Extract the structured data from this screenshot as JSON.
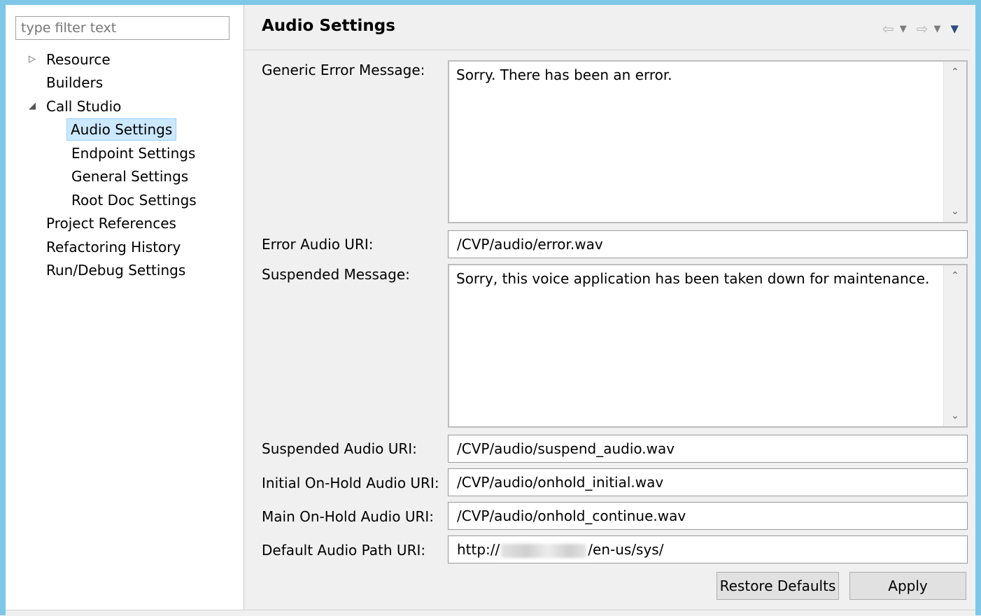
{
  "filter": {
    "placeholder": "type filter text"
  },
  "tree": {
    "items": [
      {
        "label": "Resource"
      },
      {
        "label": "Builders"
      },
      {
        "label": "Call Studio"
      },
      {
        "label": "Audio Settings"
      },
      {
        "label": "Endpoint Settings"
      },
      {
        "label": "General Settings"
      },
      {
        "label": "Root Doc Settings"
      },
      {
        "label": "Project References"
      },
      {
        "label": "Refactoring History"
      },
      {
        "label": "Run/Debug Settings"
      }
    ]
  },
  "header": {
    "title": "Audio Settings",
    "icons": {
      "back": "back-arrow-icon",
      "back_menu": "chevron-down-icon",
      "forward": "forward-arrow-icon",
      "forward_menu": "chevron-down-icon",
      "view_menu": "view-menu-icon"
    }
  },
  "form": {
    "generic_error_label": "Generic Error Message:",
    "generic_error_value": "Sorry. There has been an error.",
    "error_audio_label": "Error Audio URI:",
    "error_audio_value": "/CVP/audio/error.wav",
    "suspended_msg_label": "Suspended Message:",
    "suspended_msg_value": "Sorry, this voice application has been taken down for maintenance.",
    "suspended_audio_label": "Suspended Audio URI:",
    "suspended_audio_value": "/CVP/audio/suspend_audio.wav",
    "initial_onhold_label": "Initial On-Hold Audio URI:",
    "initial_onhold_value": "/CVP/audio/onhold_initial.wav",
    "main_onhold_label": "Main On-Hold Audio URI:",
    "main_onhold_value": "/CVP/audio/onhold_continue.wav",
    "default_path_label": "Default Audio Path URI:",
    "default_path_prefix": "http://",
    "default_path_suffix": "/en-us/sys/"
  },
  "buttons": {
    "restore": "Restore Defaults",
    "apply": "Apply"
  },
  "colors": {
    "accent_border": "#7fc7e6",
    "selection_bg": "#cce8ff",
    "selection_border": "#99d1ff"
  }
}
